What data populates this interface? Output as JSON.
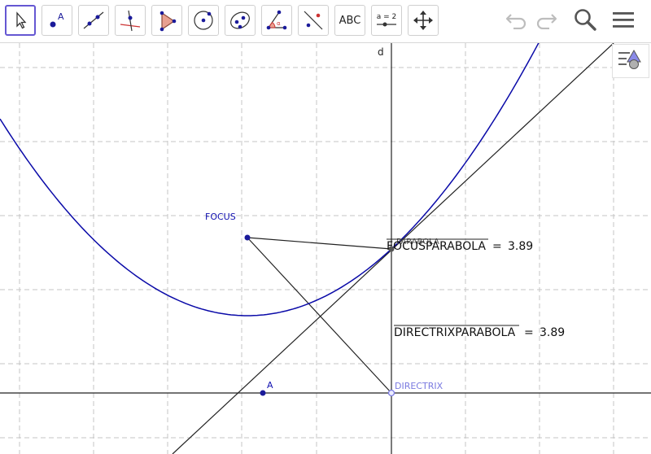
{
  "toolbar": {
    "tools": [
      {
        "name": "move-tool",
        "icon": "arrow-pointer-icon"
      },
      {
        "name": "point-tool",
        "icon": "point-icon"
      },
      {
        "name": "line-tool",
        "icon": "line-through-points-icon"
      },
      {
        "name": "perpendicular-line-tool",
        "icon": "perpendicular-line-icon"
      },
      {
        "name": "polygon-tool",
        "icon": "polygon-icon"
      },
      {
        "name": "circle-tool",
        "icon": "circle-center-point-icon"
      },
      {
        "name": "conic-tool",
        "icon": "ellipse-icon"
      },
      {
        "name": "angle-tool",
        "icon": "angle-icon"
      },
      {
        "name": "reflect-tool",
        "icon": "reflect-icon"
      },
      {
        "name": "text-tool",
        "icon": "text-icon",
        "label": "ABC"
      },
      {
        "name": "slider-tool",
        "icon": "slider-icon",
        "label": "a = 2"
      },
      {
        "name": "move-graphics-view-tool",
        "icon": "move-arrows-icon"
      }
    ],
    "undo_icon": "undo-icon",
    "redo_icon": "redo-icon",
    "search_icon": "search-icon",
    "menu_icon": "hamburger-menu-icon",
    "style_bar_icon": "style-bar-icon"
  },
  "graphics": {
    "axis_label": "d",
    "focus_label": "FOCUS",
    "point_a_label": "A",
    "directrix_label": "DIRECTRIX",
    "parabola_label": "PARABOLA",
    "focus_parabola": {
      "name": "FOCUSPARABOLA",
      "eq": "=",
      "value": "3.89"
    },
    "directrix_parabola": {
      "name": "DIRECTRIXPARABOLA",
      "eq": "=",
      "value": "3.89"
    }
  },
  "colors": {
    "accent": "#6557d2",
    "parabola": "#0a0aa8",
    "point": "#1a1a9a",
    "label_blue": "#1010b0",
    "directrix_label": "#7a7ae0",
    "grid": "#c0c0c0"
  }
}
